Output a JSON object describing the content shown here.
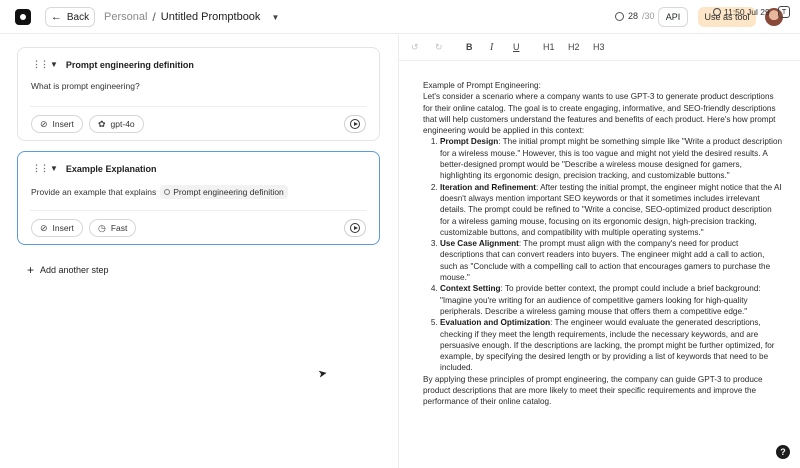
{
  "header": {
    "back_label": "Back",
    "breadcrumb_root": "Personal",
    "breadcrumb_sep": "/",
    "breadcrumb_title": "Untitled Promptbook",
    "usage_used": "28",
    "usage_total": "/30",
    "api_label": "API",
    "use_as_tool_label": "Use as tool",
    "accent_color": "#fde5c7"
  },
  "steps": [
    {
      "title": "Prompt engineering definition",
      "prompt": "What is prompt engineering?",
      "insert_label": "Insert",
      "model_label": "gpt-4o",
      "model_icon": "openai-icon"
    },
    {
      "title": "Example Explanation",
      "prompt": "Provide an example that explains",
      "reference": "Prompt engineering definition",
      "insert_label": "Insert",
      "model_label": "Fast",
      "model_icon": "clock-icon",
      "selected": true
    }
  ],
  "add_step_label": "Add another step",
  "editor": {
    "toolbar": {
      "h1": "H1",
      "h2": "H2",
      "h3": "H3",
      "bold": "B",
      "italic": "I",
      "underline": "U",
      "timestamp": "11:50 Jul 29"
    },
    "intro_title": "Example of Prompt Engineering:",
    "intro": "Let's consider a scenario where a company wants to use GPT-3 to generate product descriptions for their online catalog. The goal is to create engaging, informative, and SEO-friendly descriptions that will help customers understand the features and benefits of each product. Here's how prompt engineering would be applied in this context:",
    "items": [
      {
        "title": "Prompt Design",
        "text": ": The initial prompt might be something simple like \"Write a product description for a wireless mouse.\" However, this is too vague and might not yield the desired results. A better-designed prompt would be \"Describe a wireless mouse designed for gamers, highlighting its ergonomic design, precision tracking, and customizable buttons.\""
      },
      {
        "title": "Iteration and Refinement",
        "text": ": After testing the initial prompt, the engineer might notice that the AI doesn't always mention important SEO keywords or that it sometimes includes irrelevant details. The prompt could be refined to \"Write a concise, SEO-optimized product description for a wireless gaming mouse, focusing on its ergonomic design, high-precision tracking, customizable buttons, and compatibility with multiple operating systems.\""
      },
      {
        "title": "Use Case Alignment",
        "text": ": The prompt must align with the company's need for product descriptions that can convert readers into buyers. The engineer might add a call to action, such as \"Conclude with a compelling call to action that encourages gamers to purchase the mouse.\""
      },
      {
        "title": "Context Setting",
        "text": ": To provide better context, the prompt could include a brief background: \"Imagine you're writing for an audience of competitive gamers looking for high-quality peripherals. Describe a wireless gaming mouse that offers them a competitive edge.\""
      },
      {
        "title": "Evaluation and Optimization",
        "text": ": The engineer would evaluate the generated descriptions, checking if they meet the length requirements, include the necessary keywords, and are persuasive enough. If the descriptions are lacking, the prompt might be further optimized, for example, by specifying the desired length or by providing a list of keywords that need to be included."
      }
    ],
    "conclusion": "By applying these principles of prompt engineering, the company can guide GPT-3 to produce product descriptions that are more likely to meet their specific requirements and improve the performance of their online catalog."
  },
  "help_label": "?"
}
